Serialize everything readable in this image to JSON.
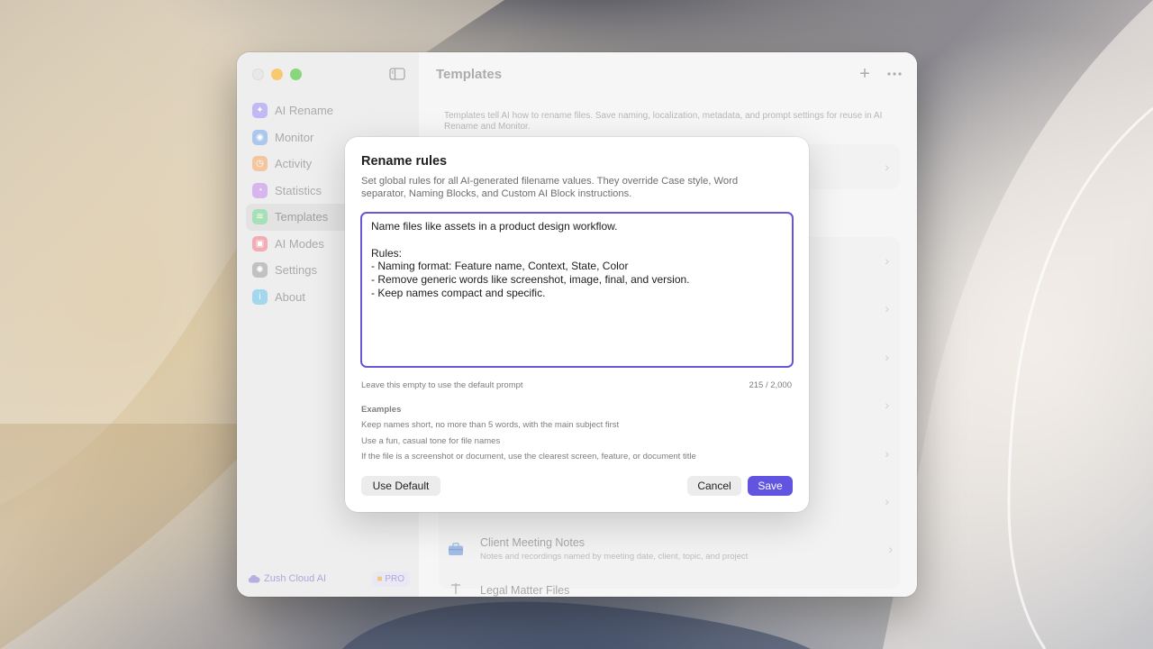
{
  "colors": {
    "accent": "#6154e0",
    "editor_border": "#6656d8",
    "traffic_min": "#f4b63a",
    "traffic_max": "#5ec64a"
  },
  "sidebar": {
    "items": [
      {
        "label": "AI Rename",
        "icon": "sparkle-icon",
        "color": "#a89ff0"
      },
      {
        "label": "Monitor",
        "icon": "eye-icon",
        "color": "#8cb2e6"
      },
      {
        "label": "Activity",
        "icon": "clock-icon",
        "color": "#efb07a"
      },
      {
        "label": "Statistics",
        "icon": "pie-chart-icon",
        "color": "#c89ae6"
      },
      {
        "label": "Templates",
        "icon": "layers-icon",
        "color": "#86d39a"
      },
      {
        "label": "AI Modes",
        "icon": "robot-icon",
        "color": "#ee8c98"
      },
      {
        "label": "Settings",
        "icon": "gear-icon",
        "color": "#a9a9a9"
      },
      {
        "label": "About",
        "icon": "info-icon",
        "color": "#7fc8e8"
      }
    ],
    "footer": {
      "cloud_label": "Zush Cloud AI",
      "badge": "PRO"
    }
  },
  "main": {
    "title": "Templates",
    "description": "Templates tell AI how to rename files. Save naming, localization, metadata, and prompt settings for reuse in AI Rename and Monitor.",
    "rows": [
      {
        "title": "Client Meeting Notes",
        "subtitle": "Notes and recordings named by meeting date, client, topic, and project",
        "icon": "briefcase-icon"
      },
      {
        "title": "Legal Matter Files",
        "subtitle": "",
        "icon": "scale-icon"
      }
    ]
  },
  "modal": {
    "title": "Rename rules",
    "description": "Set global rules for all AI-generated filename values. They override Case style, Word separator, Naming Blocks, and Custom AI Block instructions.",
    "editor_value": "Name files like assets in a product design workflow.\n\nRules:\n- Naming format: Feature name, Context, State, Color\n- Remove generic words like screenshot, image, final, and version.\n- Keep names compact and specific.",
    "hint": "Leave this empty to use the default prompt",
    "counter": "215 / 2,000",
    "examples_heading": "Examples",
    "examples": [
      "Keep names short, no more than 5 words, with the main subject first",
      "Use a fun, casual tone for file names",
      "If the file is a screenshot or document, use the clearest screen, feature, or document title"
    ],
    "buttons": {
      "use_default": "Use Default",
      "cancel": "Cancel",
      "save": "Save"
    }
  }
}
